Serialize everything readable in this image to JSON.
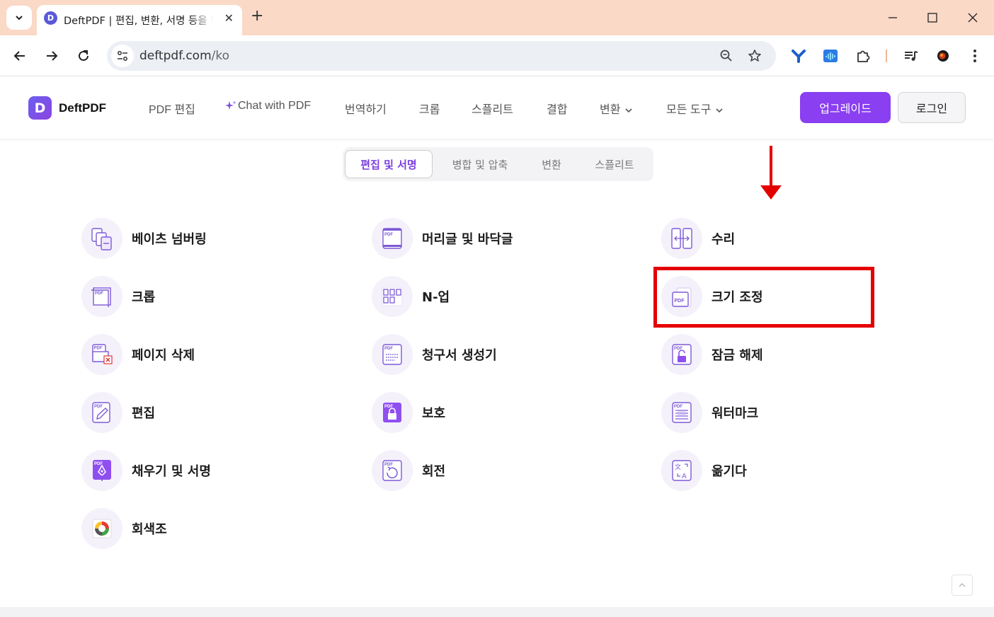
{
  "browser": {
    "tab_title": "DeftPDF | 편집, 변환, 서명 등을 위한 무료 온라인 PDF 도구",
    "favicon_letter": "D",
    "url_domain": "deftpdf.com",
    "url_path": "/ko"
  },
  "header": {
    "logo_letter": "D",
    "logo_text": "DeftPDF",
    "nav": [
      "PDF 편집",
      "Chat with PDF",
      "번역하기",
      "크롭",
      "스플리트",
      "결합",
      "변환",
      "모든 도구"
    ],
    "upgrade_label": "업그레이드",
    "login_label": "로그인",
    "accent_color": "#8a3ff0"
  },
  "category_tabs": {
    "items": [
      "편집 및 서명",
      "병합 및 압축",
      "변환",
      "스플리트"
    ],
    "active": "편집 및 서명"
  },
  "tools": [
    {
      "label": "베이츠 넘버링",
      "icon": "bates-numbering-icon"
    },
    {
      "label": "머리글 및 바닥글",
      "icon": "header-footer-icon"
    },
    {
      "label": "수리",
      "icon": "repair-icon"
    },
    {
      "label": "크롭",
      "icon": "crop-icon"
    },
    {
      "label": "N-업",
      "icon": "n-up-icon"
    },
    {
      "label": "크기 조정",
      "icon": "resize-icon"
    },
    {
      "label": "페이지 삭제",
      "icon": "delete-pages-icon"
    },
    {
      "label": "청구서 생성기",
      "icon": "invoice-generator-icon"
    },
    {
      "label": "잠금 해제",
      "icon": "unlock-icon"
    },
    {
      "label": "편집",
      "icon": "edit-icon"
    },
    {
      "label": "보호",
      "icon": "protect-icon"
    },
    {
      "label": "워터마크",
      "icon": "watermark-icon"
    },
    {
      "label": "채우기 및 서명",
      "icon": "fill-sign-icon"
    },
    {
      "label": "회전",
      "icon": "rotate-icon"
    },
    {
      "label": "옮기다",
      "icon": "translate-icon"
    },
    {
      "label": "회색조",
      "icon": "grayscale-icon"
    }
  ],
  "annotation": {
    "highlighted_tool": "크기 조정",
    "color": "#e50000"
  }
}
